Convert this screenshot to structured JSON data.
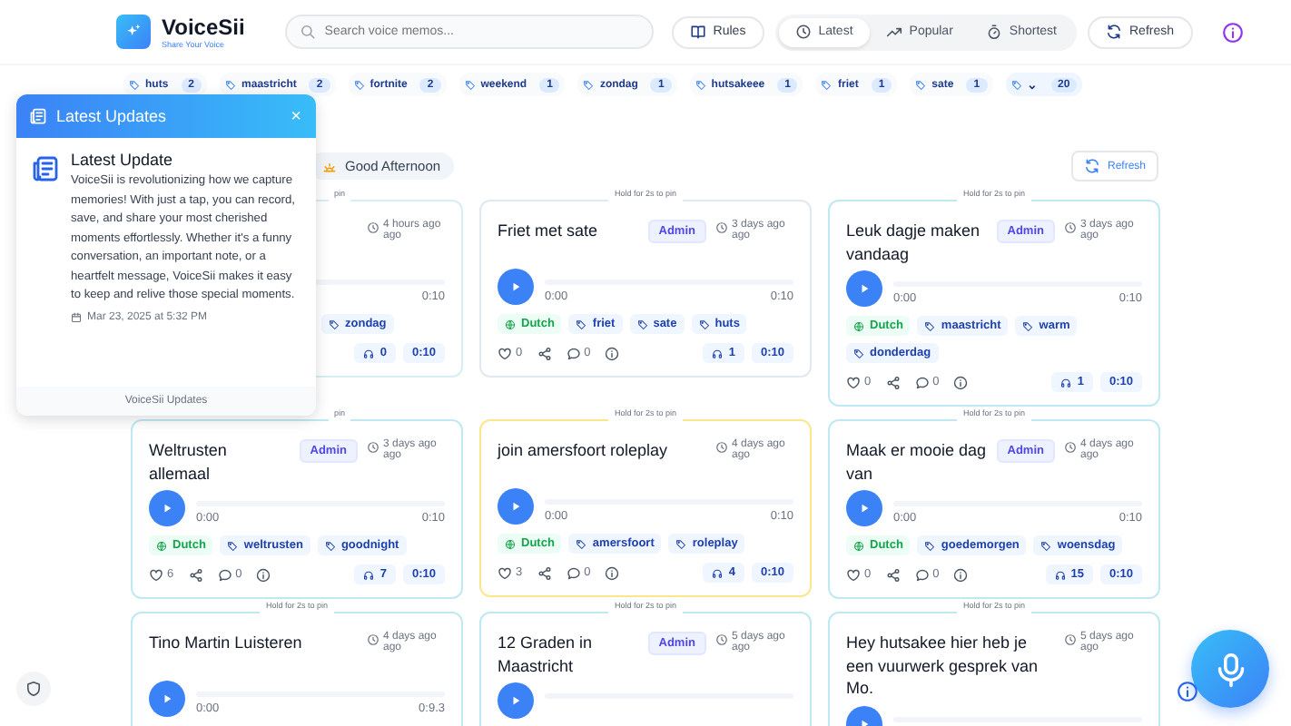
{
  "app": {
    "name": "VoiceSii",
    "tagline": "Share Your Voice"
  },
  "search": {
    "placeholder": "Search voice memos..."
  },
  "toolbar": {
    "rules": "Rules",
    "sorts": [
      {
        "label": "Latest",
        "selected": true
      },
      {
        "label": "Popular",
        "selected": false
      },
      {
        "label": "Shortest",
        "selected": false
      }
    ],
    "refresh": "Refresh"
  },
  "tags": [
    {
      "kind": "tag",
      "label": "huts",
      "count": "2"
    },
    {
      "kind": "tag",
      "label": "maastricht",
      "count": "2"
    },
    {
      "kind": "tag",
      "label": "fortnite",
      "count": "2"
    },
    {
      "kind": "tag",
      "label": "weekend",
      "count": "1"
    },
    {
      "kind": "tag",
      "label": "zondag",
      "count": "1"
    },
    {
      "kind": "tag",
      "label": "hutsakeee",
      "count": "1"
    },
    {
      "kind": "tag",
      "label": "friet",
      "count": "1"
    },
    {
      "kind": "tag",
      "label": "sate",
      "count": "1"
    },
    {
      "kind": "more",
      "label": "⌄",
      "count": "20"
    }
  ],
  "updates_panel": {
    "title": "Latest Updates",
    "close": "×",
    "heading": "Latest Update",
    "body": "VoiceSii is revolutionizing how we capture memories! With just a tap, you can record, save, and share your most cherished moments effortlessly. Whether it's a funny conversation, an important note, or a heartfelt message, VoiceSii makes it easy to keep and relive those special moments.",
    "date": "Mar 23, 2025 at 5:32 PM",
    "footer": "VoiceSii Updates"
  },
  "greeting": "Good Afternoon",
  "refresh": "Refresh",
  "memos": [
    {
      "pin_hint": "pin",
      "color": "#d6eef5",
      "time": "4 hours ago ago",
      "duration": "0:10",
      "tags": [
        "zondag"
      ],
      "listens": "0",
      "length": "0:10"
    },
    {
      "pin_hint": "Hold for 2s to pin",
      "color": "#e2e8f0",
      "title": "Friet met sate",
      "badge": "Admin",
      "time": "3 days ago ago",
      "elapsed": "0:00",
      "duration": "0:10",
      "language": "Dutch",
      "tags": [
        "friet",
        "sate",
        "huts"
      ],
      "likes": "0",
      "comments": "0",
      "listens": "1",
      "length": "0:10"
    },
    {
      "pin_hint": "Hold for 2s to pin",
      "color": "#bfe9f2",
      "title": "Leuk dagje maken vandaag",
      "badge": "Admin",
      "time": "3 days ago ago",
      "elapsed": "0:00",
      "duration": "0:10",
      "language": "Dutch",
      "tags": [
        "maastricht",
        "warm",
        "donderdag"
      ],
      "likes": "0",
      "comments": "0",
      "listens": "1",
      "length": "0:10"
    },
    {
      "pin_hint": "pin",
      "color": "#bfe9f2",
      "title": "Weltrusten allemaal",
      "badge": "Admin",
      "time": "3 days ago ago",
      "elapsed": "0:00",
      "duration": "0:10",
      "language": "Dutch",
      "tags": [
        "weltrusten",
        "goodnight"
      ],
      "likes": "6",
      "comments": "0",
      "listens": "7",
      "length": "0:10"
    },
    {
      "pin_hint": "Hold for 2s to pin",
      "color": "#fde68a",
      "title": "join amersfoort roleplay",
      "time": "4 days ago ago",
      "elapsed": "0:00",
      "duration": "0:10",
      "language": "Dutch",
      "tags": [
        "amersfoort",
        "roleplay"
      ],
      "likes": "3",
      "comments": "0",
      "listens": "4",
      "length": "0:10"
    },
    {
      "pin_hint": "Hold for 2s to pin",
      "color": "#bfe9f2",
      "title": "Maak er mooie dag van",
      "badge": "Admin",
      "time": "4 days ago ago",
      "elapsed": "0:00",
      "duration": "0:10",
      "language": "Dutch",
      "tags": [
        "goedemorgen",
        "woensdag"
      ],
      "likes": "0",
      "comments": "0",
      "listens": "15",
      "length": "0:10"
    },
    {
      "pin_hint": "Hold for 2s to pin",
      "color": "#bfe9f2",
      "title": "Tino Martin Luisteren",
      "time": "4 days ago ago",
      "elapsed": "0:00",
      "duration": "0:9.3"
    },
    {
      "pin_hint": "Hold for 2s to pin",
      "color": "#bfe9f2",
      "title": "12 Graden in Maastricht",
      "badge": "Admin",
      "time": "5 days ago ago"
    },
    {
      "pin_hint": "Hold for 2s to pin",
      "color": "#bfe9f2",
      "title": "Hey hutsakee hier heb je een vuurwerk gesprek van Mo.",
      "time": "5 days ago ago"
    }
  ]
}
